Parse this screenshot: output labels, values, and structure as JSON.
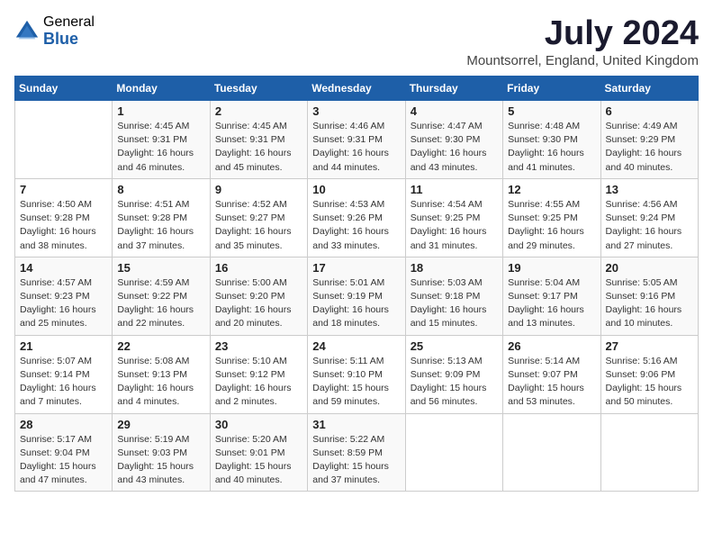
{
  "header": {
    "logo_general": "General",
    "logo_blue": "Blue",
    "month_title": "July 2024",
    "subtitle": "Mountsorrel, England, United Kingdom"
  },
  "days_of_week": [
    "Sunday",
    "Monday",
    "Tuesday",
    "Wednesday",
    "Thursday",
    "Friday",
    "Saturday"
  ],
  "weeks": [
    [
      {
        "day": "",
        "info": ""
      },
      {
        "day": "1",
        "info": "Sunrise: 4:45 AM\nSunset: 9:31 PM\nDaylight: 16 hours\nand 46 minutes."
      },
      {
        "day": "2",
        "info": "Sunrise: 4:45 AM\nSunset: 9:31 PM\nDaylight: 16 hours\nand 45 minutes."
      },
      {
        "day": "3",
        "info": "Sunrise: 4:46 AM\nSunset: 9:31 PM\nDaylight: 16 hours\nand 44 minutes."
      },
      {
        "day": "4",
        "info": "Sunrise: 4:47 AM\nSunset: 9:30 PM\nDaylight: 16 hours\nand 43 minutes."
      },
      {
        "day": "5",
        "info": "Sunrise: 4:48 AM\nSunset: 9:30 PM\nDaylight: 16 hours\nand 41 minutes."
      },
      {
        "day": "6",
        "info": "Sunrise: 4:49 AM\nSunset: 9:29 PM\nDaylight: 16 hours\nand 40 minutes."
      }
    ],
    [
      {
        "day": "7",
        "info": "Sunrise: 4:50 AM\nSunset: 9:28 PM\nDaylight: 16 hours\nand 38 minutes."
      },
      {
        "day": "8",
        "info": "Sunrise: 4:51 AM\nSunset: 9:28 PM\nDaylight: 16 hours\nand 37 minutes."
      },
      {
        "day": "9",
        "info": "Sunrise: 4:52 AM\nSunset: 9:27 PM\nDaylight: 16 hours\nand 35 minutes."
      },
      {
        "day": "10",
        "info": "Sunrise: 4:53 AM\nSunset: 9:26 PM\nDaylight: 16 hours\nand 33 minutes."
      },
      {
        "day": "11",
        "info": "Sunrise: 4:54 AM\nSunset: 9:25 PM\nDaylight: 16 hours\nand 31 minutes."
      },
      {
        "day": "12",
        "info": "Sunrise: 4:55 AM\nSunset: 9:25 PM\nDaylight: 16 hours\nand 29 minutes."
      },
      {
        "day": "13",
        "info": "Sunrise: 4:56 AM\nSunset: 9:24 PM\nDaylight: 16 hours\nand 27 minutes."
      }
    ],
    [
      {
        "day": "14",
        "info": "Sunrise: 4:57 AM\nSunset: 9:23 PM\nDaylight: 16 hours\nand 25 minutes."
      },
      {
        "day": "15",
        "info": "Sunrise: 4:59 AM\nSunset: 9:22 PM\nDaylight: 16 hours\nand 22 minutes."
      },
      {
        "day": "16",
        "info": "Sunrise: 5:00 AM\nSunset: 9:20 PM\nDaylight: 16 hours\nand 20 minutes."
      },
      {
        "day": "17",
        "info": "Sunrise: 5:01 AM\nSunset: 9:19 PM\nDaylight: 16 hours\nand 18 minutes."
      },
      {
        "day": "18",
        "info": "Sunrise: 5:03 AM\nSunset: 9:18 PM\nDaylight: 16 hours\nand 15 minutes."
      },
      {
        "day": "19",
        "info": "Sunrise: 5:04 AM\nSunset: 9:17 PM\nDaylight: 16 hours\nand 13 minutes."
      },
      {
        "day": "20",
        "info": "Sunrise: 5:05 AM\nSunset: 9:16 PM\nDaylight: 16 hours\nand 10 minutes."
      }
    ],
    [
      {
        "day": "21",
        "info": "Sunrise: 5:07 AM\nSunset: 9:14 PM\nDaylight: 16 hours\nand 7 minutes."
      },
      {
        "day": "22",
        "info": "Sunrise: 5:08 AM\nSunset: 9:13 PM\nDaylight: 16 hours\nand 4 minutes."
      },
      {
        "day": "23",
        "info": "Sunrise: 5:10 AM\nSunset: 9:12 PM\nDaylight: 16 hours\nand 2 minutes."
      },
      {
        "day": "24",
        "info": "Sunrise: 5:11 AM\nSunset: 9:10 PM\nDaylight: 15 hours\nand 59 minutes."
      },
      {
        "day": "25",
        "info": "Sunrise: 5:13 AM\nSunset: 9:09 PM\nDaylight: 15 hours\nand 56 minutes."
      },
      {
        "day": "26",
        "info": "Sunrise: 5:14 AM\nSunset: 9:07 PM\nDaylight: 15 hours\nand 53 minutes."
      },
      {
        "day": "27",
        "info": "Sunrise: 5:16 AM\nSunset: 9:06 PM\nDaylight: 15 hours\nand 50 minutes."
      }
    ],
    [
      {
        "day": "28",
        "info": "Sunrise: 5:17 AM\nSunset: 9:04 PM\nDaylight: 15 hours\nand 47 minutes."
      },
      {
        "day": "29",
        "info": "Sunrise: 5:19 AM\nSunset: 9:03 PM\nDaylight: 15 hours\nand 43 minutes."
      },
      {
        "day": "30",
        "info": "Sunrise: 5:20 AM\nSunset: 9:01 PM\nDaylight: 15 hours\nand 40 minutes."
      },
      {
        "day": "31",
        "info": "Sunrise: 5:22 AM\nSunset: 8:59 PM\nDaylight: 15 hours\nand 37 minutes."
      },
      {
        "day": "",
        "info": ""
      },
      {
        "day": "",
        "info": ""
      },
      {
        "day": "",
        "info": ""
      }
    ]
  ]
}
